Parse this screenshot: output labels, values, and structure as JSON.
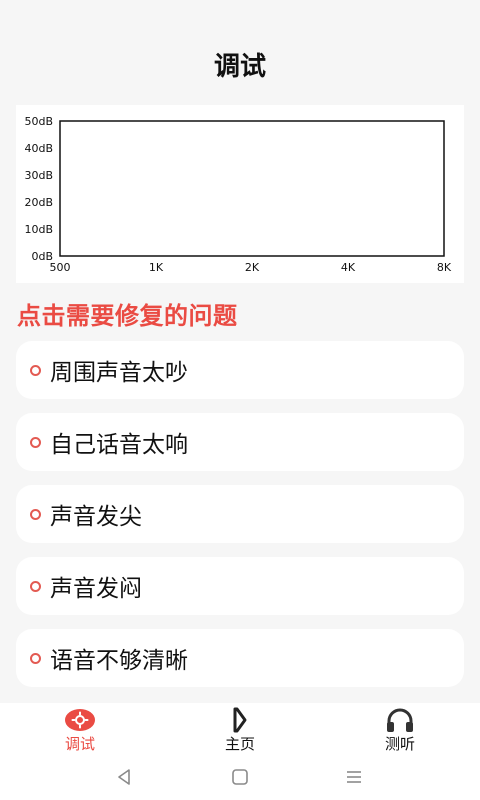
{
  "header": {
    "title": "调试"
  },
  "chart_data": {
    "type": "line",
    "title": "",
    "xlabel": "",
    "ylabel": "",
    "x_tick_labels": [
      "500",
      "1K",
      "2K",
      "4K",
      "8K"
    ],
    "y_tick_labels": [
      "0dB",
      "10dB",
      "20dB",
      "30dB",
      "40dB",
      "50dB"
    ],
    "ylim": [
      0,
      50
    ],
    "series": [],
    "grid": false
  },
  "section": {
    "title": "点击需要修复的问题"
  },
  "options": [
    {
      "label": "周围声音太吵"
    },
    {
      "label": "自己话音太响"
    },
    {
      "label": "声音发尖"
    },
    {
      "label": "声音发闷"
    },
    {
      "label": "语音不够清晰"
    }
  ],
  "tabbar": {
    "items": [
      {
        "label": "调试",
        "icon": "gear-icon",
        "active": true
      },
      {
        "label": "主页",
        "icon": "home-logo-icon",
        "active": false
      },
      {
        "label": "测听",
        "icon": "headphones-icon",
        "active": false
      }
    ]
  },
  "colors": {
    "accent": "#ea4b43",
    "text": "#111111",
    "background": "#f6f6f6"
  }
}
